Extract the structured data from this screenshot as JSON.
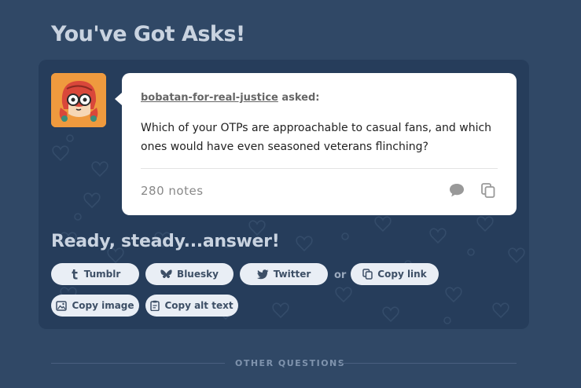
{
  "page": {
    "title": "You've Got Asks!"
  },
  "ask": {
    "asker": "bobatan-for-real-justice",
    "asked_suffix": " asked:",
    "question": "Which of your OTPs are approachable to casual fans, and which ones would have even seasoned veterans flinching?",
    "notes": "280 notes",
    "icons": {
      "comment": "comment-icon",
      "copy": "copy-icon"
    }
  },
  "answer": {
    "heading": "Ready, steady...answer!",
    "buttons": {
      "tumblr": "Tumblr",
      "bluesky": "Bluesky",
      "twitter": "Twitter",
      "or": "or",
      "copy_link": "Copy link",
      "copy_image": "Copy image",
      "copy_alt_text": "Copy alt text"
    }
  },
  "other": {
    "label": "OTHER QUESTIONS"
  },
  "colors": {
    "background": "#304866",
    "panel": "#263d5b",
    "pill": "#e9eef5",
    "avatar": "#ef9a3e"
  }
}
